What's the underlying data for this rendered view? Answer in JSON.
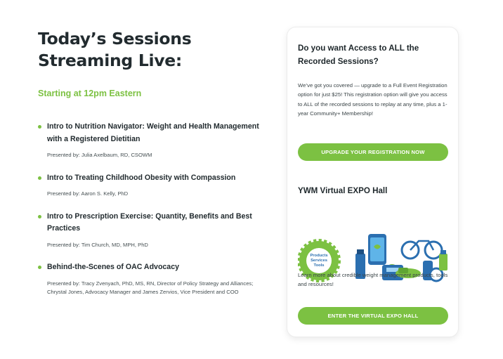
{
  "heading": {
    "line1": "Today’s Sessions",
    "line2": "Streaming Live:"
  },
  "start_time": "Starting at 12pm Eastern",
  "sessions": [
    {
      "title": "Intro to Nutrition Navigator: Weight and Health Management with a Registered Dietitian",
      "presenter": "Presented by: Julia Axelbaum, RD, CSOWM"
    },
    {
      "title": "Intro to Treating Childhood Obesity with Compassion",
      "presenter": "Presented by: Aaron S. Kelly, PhD"
    },
    {
      "title": "Intro to Prescription Exercise: Quantity, Benefits and Best Practices",
      "presenter": "Presented by: Tim Church, MD, MPH, PhD"
    },
    {
      "title": "Behind-the-Scenes of OAC Advocacy",
      "presenter": "Presented by: Tracy Zvenyach, PhD, MS, RN, Director of Policy Strategy and Alliances; Chrystal Jones, Advocacy Manager and James Zervios, Vice President and COO"
    }
  ],
  "card": {
    "access_heading": "Do you want Access to ALL the Recorded Sessions?",
    "access_text": "We’ve got you covered — upgrade to a Full Event Registration option for just $25! This registration option will give you access to ALL of the recorded sessions to replay at any time, plus a 1-year Community+ Membership!",
    "upgrade_button": "UPGRADE YOUR REGISTRATION NOW",
    "expo_heading": "YWM Virtual EXPO Hall",
    "badge_text": [
      "Products",
      "Services",
      "Tools"
    ],
    "expo_text": "Learn more about credible weight management products, tools and resources!",
    "expo_button": "ENTER THE VIRTUAL EXPO HALL"
  },
  "colors": {
    "accent": "#7cc142",
    "illustration_blue": "#2b6fb0",
    "heading": "#222b2f"
  }
}
